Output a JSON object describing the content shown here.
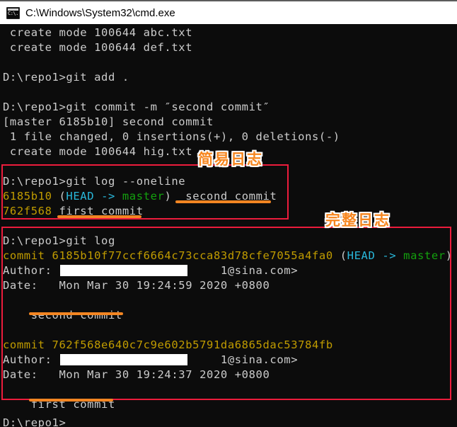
{
  "window": {
    "title": "C:\\Windows\\System32\\cmd.exe",
    "icon": "cmd-console-icon"
  },
  "colors": {
    "console_bg": "#0c0c0c",
    "console_fg": "#cccccc",
    "commit_hash": "#c19c00",
    "head_ref": "#29b8db",
    "branch_ref": "#13a10e",
    "annotation_box": "#ec1c3c",
    "annotation_underline": "#f28522",
    "annotation_label": "#f6861f"
  },
  "console": {
    "lines": [
      {
        "id": "l01",
        "text": " create mode 100644 abc.txt"
      },
      {
        "id": "l02",
        "text": " create mode 100644 def.txt"
      },
      {
        "id": "l03",
        "text": ""
      },
      {
        "id": "l04",
        "text": "D:\\repo1>git add ."
      },
      {
        "id": "l05",
        "text": ""
      },
      {
        "id": "l06",
        "text": "D:\\repo1>git commit -m ″second commit″"
      },
      {
        "id": "l07",
        "text": "[master 6185b10] second commit"
      },
      {
        "id": "l08",
        "text": " 1 file changed, 0 insertions(+), 0 deletions(-)"
      },
      {
        "id": "l09",
        "text": " create mode 100644 hig.txt"
      },
      {
        "id": "l10",
        "text": ""
      },
      {
        "id": "l11",
        "text": "D:\\repo1>git log --oneline"
      },
      {
        "id": "l12_hash",
        "text": "6185b10"
      },
      {
        "id": "l12_open",
        "text": " ("
      },
      {
        "id": "l12_head",
        "text": "HEAD -> "
      },
      {
        "id": "l12_branch",
        "text": "master"
      },
      {
        "id": "l12_close",
        "text": ")  second commit"
      },
      {
        "id": "l13_hash",
        "text": "762f568"
      },
      {
        "id": "l13_msg",
        "text": " first commit"
      },
      {
        "id": "l14",
        "text": ""
      },
      {
        "id": "l15",
        "text": "D:\\repo1>git log"
      },
      {
        "id": "l16_commit",
        "text": "commit 6185b10f77ccf6664c73cca83d78cfe7055a4fa0"
      },
      {
        "id": "l16_open",
        "text": " ("
      },
      {
        "id": "l16_head",
        "text": "HEAD -> "
      },
      {
        "id": "l16_branch",
        "text": "master"
      },
      {
        "id": "l16_close",
        "text": ")"
      },
      {
        "id": "l17_pre",
        "text": "Author: z"
      },
      {
        "id": "l17_post",
        "text": "1@sina.com>"
      },
      {
        "id": "l18",
        "text": "Date:   Mon Mar 30 19:24:59 2020 +0800"
      },
      {
        "id": "l19",
        "text": ""
      },
      {
        "id": "l20",
        "text": "    second commit"
      },
      {
        "id": "l21",
        "text": ""
      },
      {
        "id": "l22_commit",
        "text": "commit 762f568e640c7c9e602b5791da6865dac53784fb"
      },
      {
        "id": "l23_pre",
        "text": "Author: z"
      },
      {
        "id": "l23_post",
        "text": "1@sina.com>"
      },
      {
        "id": "l24",
        "text": "Date:   Mon Mar 30 19:24:37 2020 +0800"
      },
      {
        "id": "l25",
        "text": ""
      },
      {
        "id": "l26",
        "text": "    first commit"
      },
      {
        "id": "l27",
        "text": ""
      },
      {
        "id": "l28",
        "text": "D:\\repo1>"
      }
    ]
  },
  "annotations": {
    "labels": [
      {
        "id": "simple-log",
        "text": "简易日志"
      },
      {
        "id": "full-log",
        "text": "完整日志"
      }
    ]
  }
}
